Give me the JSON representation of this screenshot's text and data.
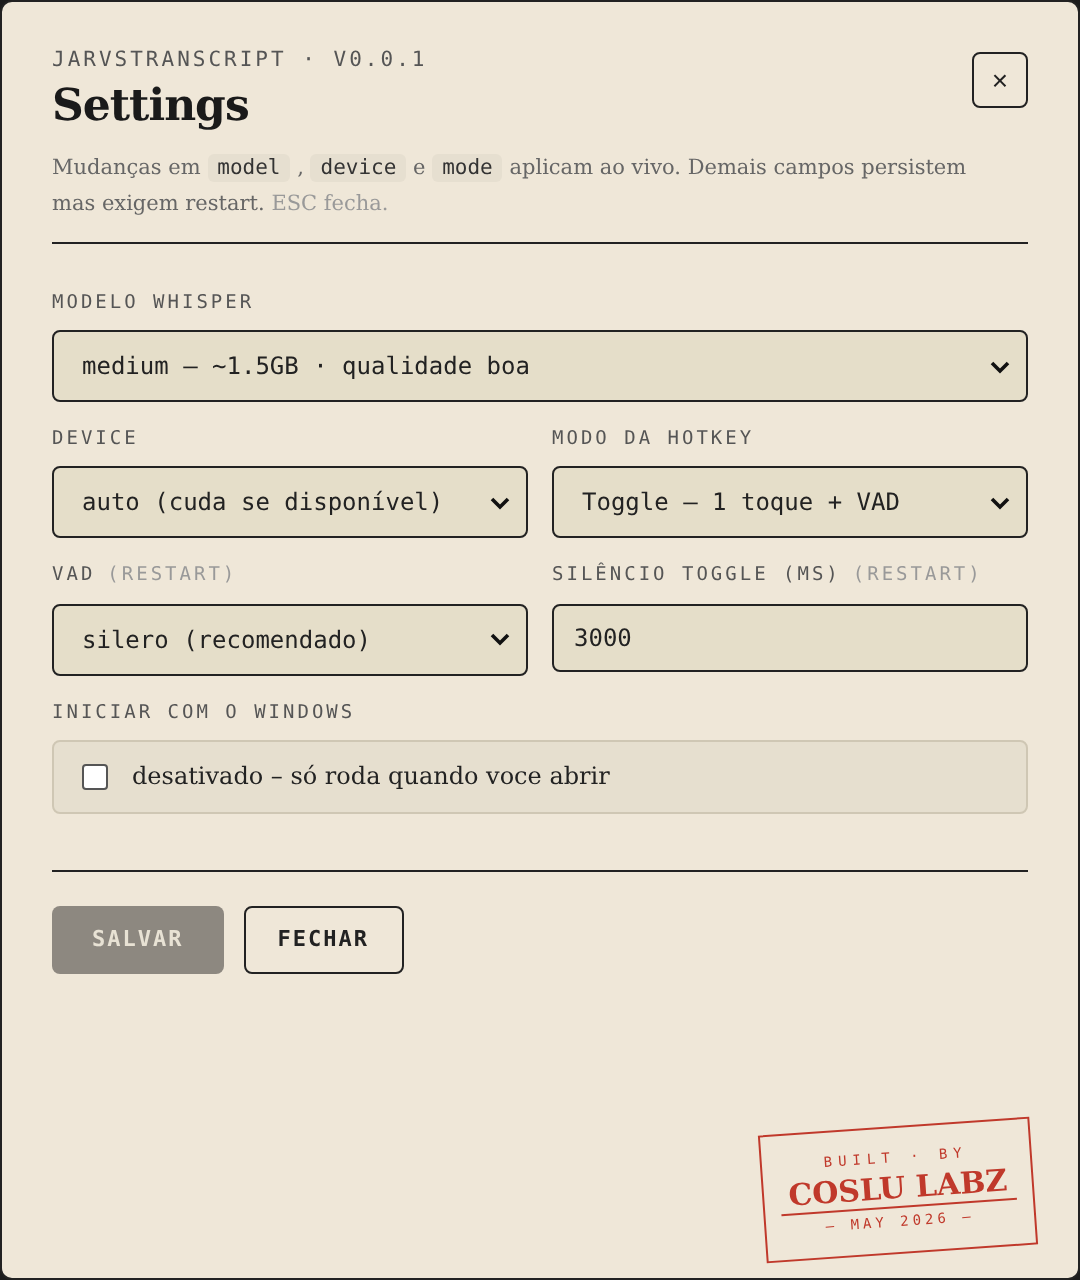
{
  "header": {
    "eyebrow": "JARVSTRANSCRIPT · V0.0.1",
    "title": "Settings",
    "close": "×"
  },
  "description": [
    {
      "kind": "text",
      "text": "Mudanças em "
    },
    {
      "kind": "code",
      "text": "model"
    },
    {
      "kind": "text",
      "text": " , "
    },
    {
      "kind": "code",
      "text": "device"
    },
    {
      "kind": "text",
      "text": " e "
    },
    {
      "kind": "code",
      "text": "mode"
    },
    {
      "kind": "text",
      "text": " aplicam ao vivo. Demais campos persistem mas exigem restart. "
    },
    {
      "kind": "hint",
      "text": "ESC fecha."
    }
  ],
  "rows": [
    [
      {
        "kind": "select",
        "label": "MODELO WHISPER",
        "value": "medium — ~1.5GB · qualidade boa"
      }
    ],
    [
      {
        "kind": "select",
        "label": "DEVICE",
        "value": "auto (cuda se disponível)"
      },
      {
        "kind": "select",
        "label": "MODO DA HOTKEY",
        "value": "Toggle — 1 toque + VAD"
      }
    ],
    [
      {
        "kind": "select",
        "label": "VAD",
        "note": "(RESTART)",
        "value": "silero (recomendado)"
      },
      {
        "kind": "input",
        "label": "SILÊNCIO TOGGLE (MS)",
        "note": "(RESTART)",
        "value": "3000"
      }
    ],
    [
      {
        "kind": "checkbox",
        "label": "INICIAR COM O WINDOWS",
        "value": "desativado – só roda quando voce abrir",
        "checked": false
      }
    ]
  ],
  "buttons": [
    {
      "kind": "primary",
      "label": "SALVAR",
      "disabled": true
    },
    {
      "kind": "secondary",
      "label": "FECHAR",
      "disabled": false
    }
  ],
  "stamp": {
    "top": "BUILT · BY",
    "name": "COSLU LABZ",
    "bottom": "— MAY 2026 —"
  }
}
